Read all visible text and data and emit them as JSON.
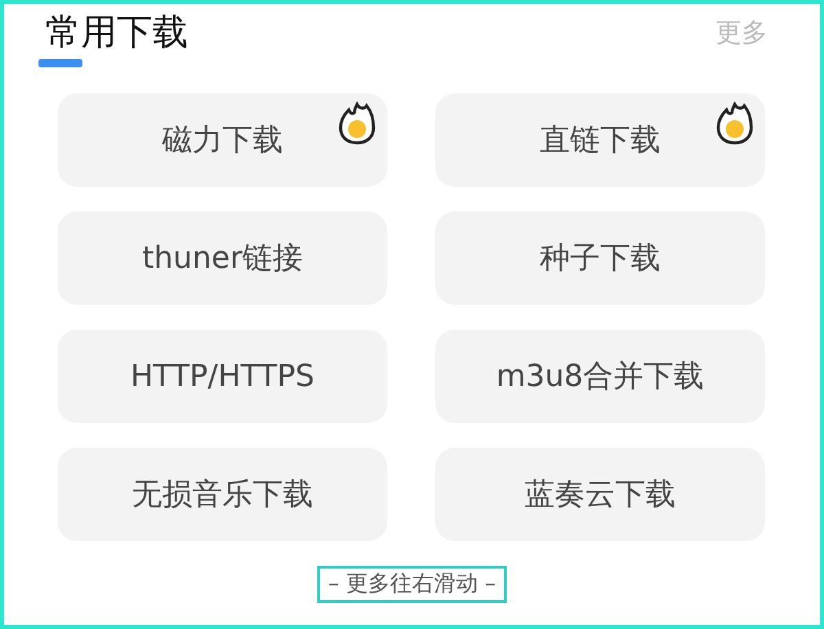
{
  "header": {
    "title": "常用下载",
    "more_link": "更多"
  },
  "buttons": [
    {
      "label": "磁力下载",
      "hot": true
    },
    {
      "label": "直链下载",
      "hot": true
    },
    {
      "label": "thuner链接",
      "hot": false
    },
    {
      "label": "种子下载",
      "hot": false
    },
    {
      "label": "HTTP/HTTPS",
      "hot": false
    },
    {
      "label": "m3u8合并下载",
      "hot": false
    },
    {
      "label": "无损音乐下载",
      "hot": false
    },
    {
      "label": "蓝奏云下载",
      "hot": false
    }
  ],
  "footer_hint": "– 更多往右滑动 –"
}
